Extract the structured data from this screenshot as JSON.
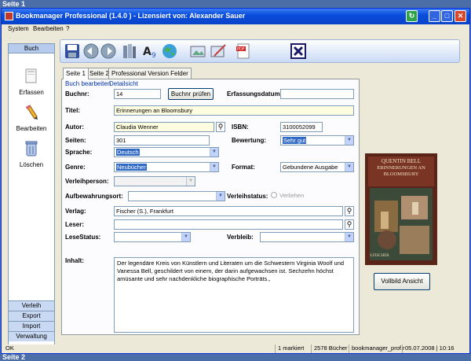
{
  "page": {
    "caption_top": "Seite 1",
    "caption_bottom": "Seite 2"
  },
  "window": {
    "title": "Bookmanager Professional (1.4.0 ) - Lizensiert von: Alexander Sauer"
  },
  "menu": {
    "items": [
      "System",
      "Bearbeiten",
      "?"
    ]
  },
  "sidebar": {
    "header": "Buch",
    "items": [
      {
        "label": "Erfassen",
        "icon": "book-icon"
      },
      {
        "label": "Bearbeiten",
        "icon": "pencil-icon"
      },
      {
        "label": "Löschen",
        "icon": "trash-icon"
      }
    ],
    "footer": [
      "Verleih",
      "Export",
      "Import",
      "Verwaltung"
    ]
  },
  "toolbar": {
    "buttons": [
      "save-icon",
      "back-icon",
      "forward-icon",
      "library-icon",
      "spellcheck-icon",
      "globe-icon",
      "image-icon",
      "image-edit-icon",
      "pdf-icon",
      "close-icon"
    ]
  },
  "tabs": [
    "Seite 1",
    "Seite 2",
    "Professional Version Felder"
  ],
  "form": {
    "links": {
      "edit": "Buch bearbeiten",
      "detail": "Detailsicht"
    },
    "buchnr": {
      "label": "Buchnr:",
      "value": "14"
    },
    "buchnr_check": "Buchnr prüfen",
    "erfassungsdatum": {
      "label": "Erfassungsdatum:",
      "value": ""
    },
    "titel": {
      "label": "Titel:",
      "value": "Erinnerungen an Bloomsbury"
    },
    "autor": {
      "label": "Autor:",
      "value": "Claudia Wenner"
    },
    "isbn": {
      "label": "ISBN:",
      "value": "3100052099"
    },
    "seiten": {
      "label": "Seiten:",
      "value": "301"
    },
    "bewertung": {
      "label": "Bewertung:",
      "value": "Sehr gut"
    },
    "sprache": {
      "label": "Sprache:",
      "value": "Deutsch"
    },
    "genre": {
      "label": "Genre:",
      "value": "Neubücher"
    },
    "format": {
      "label": "Format:",
      "value": "Gebundene Ausgabe"
    },
    "verleihperson": {
      "label": "Verleihperson:",
      "value": ""
    },
    "aufbewahrungsort": {
      "label": "Aufbewahrungsort:",
      "value": ""
    },
    "verleihstatus": {
      "label": "Verleihstatus:",
      "option": "Verliehen"
    },
    "verlag": {
      "label": "Verlag:",
      "value": "Fischer (S.), Frankfurt"
    },
    "leser": {
      "label": "Leser:",
      "value": ""
    },
    "lesestatus": {
      "label": "LeseStatus:",
      "value": ""
    },
    "verbleib": {
      "label": "Verbleib:",
      "value": ""
    },
    "inhalt": {
      "label": "Inhalt:",
      "value": "Der legendäre Kreis von Künstlern und Literaten um die Schwestern Virginia Woolf und Vanessa Bell, geschildert von einem, der darin aufgewachsen ist. Sechzehn höchst amüsante und sehr nachdenkliche biographische Porträts.,"
    }
  },
  "cover": {
    "author": "QUENTIN BELL",
    "title_line1": "ERINNERUNGEN AN",
    "title_line2": "BLOOMSBURY",
    "publisher": "S.FISCHER",
    "button": "Vollbild Ansicht"
  },
  "statusbar": {
    "status": "OK",
    "marked": "1 markiert",
    "count": "2578 Bücher",
    "profile": "bookmanager_prof.r",
    "datetime": "05.07.2008 | 10:16"
  }
}
